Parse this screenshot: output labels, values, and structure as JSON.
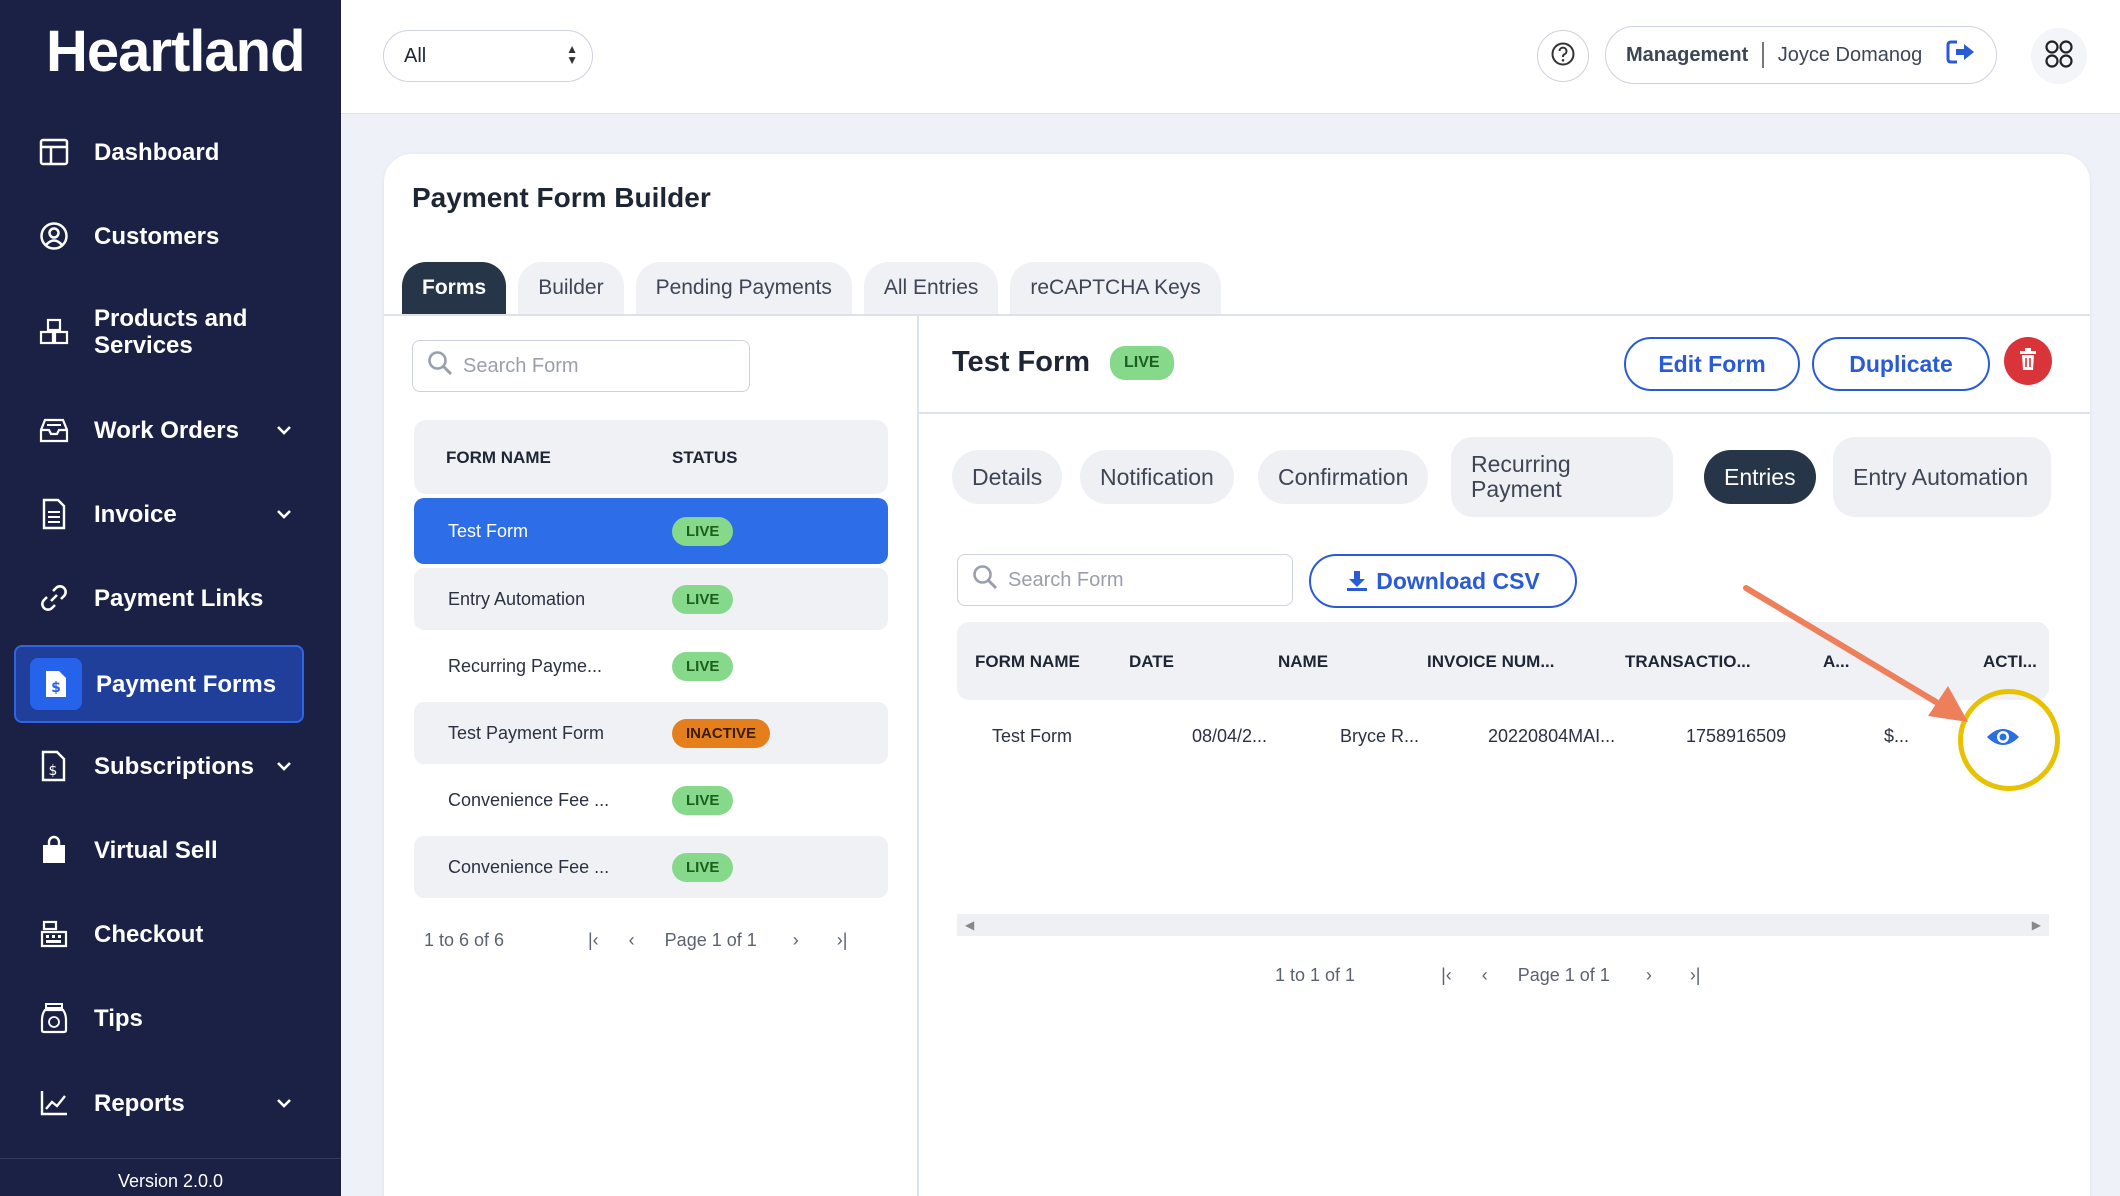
{
  "brand": "Heartland",
  "version": "Version 2.0.0",
  "sidebar": {
    "items": [
      {
        "label": "Dashboard",
        "icon": "dashboard-icon"
      },
      {
        "label": "Customers",
        "icon": "user-circle-icon"
      },
      {
        "label": "Products and Services",
        "icon": "boxes-icon"
      },
      {
        "label": "Work Orders",
        "icon": "tray-icon",
        "has_chevron": true
      },
      {
        "label": "Invoice",
        "icon": "document-icon",
        "has_chevron": true
      },
      {
        "label": "Payment Links",
        "icon": "link-icon"
      },
      {
        "label": "Payment Forms",
        "icon": "payment-form-icon",
        "active": true
      },
      {
        "label": "Subscriptions",
        "icon": "subscription-icon",
        "has_chevron": true
      },
      {
        "label": "Virtual Sell",
        "icon": "bag-icon"
      },
      {
        "label": "Checkout",
        "icon": "register-icon"
      },
      {
        "label": "Tips",
        "icon": "tip-jar-icon"
      },
      {
        "label": "Reports",
        "icon": "chart-icon",
        "has_chevron": true
      }
    ]
  },
  "topbar": {
    "location_select": "All",
    "role": "Management",
    "user_name": "Joyce Domanog"
  },
  "page": {
    "title": "Payment Form Builder",
    "tabs": [
      "Forms",
      "Builder",
      "Pending Payments",
      "All Entries",
      "reCAPTCHA Keys"
    ],
    "active_tab": "Forms"
  },
  "forms_list": {
    "search_placeholder": "Search Form",
    "columns": [
      "FORM NAME",
      "STATUS"
    ],
    "rows": [
      {
        "name": "Test Form",
        "status": "LIVE"
      },
      {
        "name": "Entry Automation",
        "status": "LIVE"
      },
      {
        "name": "Recurring Payme...",
        "status": "LIVE"
      },
      {
        "name": "Test Payment Form",
        "status": "INACTIVE"
      },
      {
        "name": "Convenience Fee ...",
        "status": "LIVE"
      },
      {
        "name": "Convenience Fee ...",
        "status": "LIVE"
      }
    ],
    "range": "1 to 6 of 6",
    "page": "Page 1 of 1"
  },
  "detail": {
    "title": "Test Form",
    "status": "LIVE",
    "edit_label": "Edit Form",
    "duplicate_label": "Duplicate",
    "subtabs": [
      "Details",
      "Notification",
      "Confirmation",
      "Recurring Payment",
      "Entries",
      "Entry Automation"
    ],
    "active_subtab": "Entries",
    "search_placeholder": "Search Form",
    "download_label": "Download CSV",
    "columns": [
      "FORM NAME",
      "DATE",
      "NAME",
      "INVOICE NUM...",
      "TRANSACTIO...",
      "A...",
      "ACTI..."
    ],
    "rows": [
      {
        "form_name": "Test Form",
        "date": "08/04/2...",
        "name": "Bryce R...",
        "invoice": "20220804MAI...",
        "transaction": "1758916509",
        "amount": "$..."
      }
    ],
    "range": "1 to 1 of 1",
    "page": "Page 1 of 1"
  },
  "colors": {
    "sidebar_bg": "#1b2144",
    "accent": "#2a5bd7",
    "live": "#86d98a",
    "inactive": "#e57f1c",
    "annotation_arrow": "#ee7f5b",
    "annotation_circle": "#e8c100"
  }
}
